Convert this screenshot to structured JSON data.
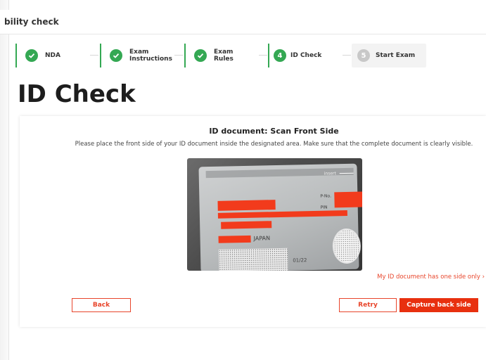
{
  "topbar": {
    "title": "bility check"
  },
  "stepper": {
    "steps": [
      {
        "label": "NDA",
        "state": "done"
      },
      {
        "label_line1": "Exam",
        "label_line2": "Instructions",
        "state": "done"
      },
      {
        "label_line1": "Exam",
        "label_line2": "Rules",
        "state": "done"
      },
      {
        "number": "4",
        "label": "ID Check",
        "state": "current"
      },
      {
        "number": "5",
        "label": "Start Exam",
        "state": "upcoming"
      }
    ]
  },
  "page": {
    "title": "ID Check"
  },
  "card": {
    "heading": "ID document: Scan Front Side",
    "description": "Please place the front side of your ID document inside the designated area. Make sure that the complete document is clearly visible.",
    "id_image": {
      "insert_label": "insert",
      "country": "JAPAN",
      "field_pno": "P-No.",
      "field_pin": "PIN",
      "expiry": "01/22"
    },
    "one_side_link": "My ID document has one side only",
    "buttons": {
      "back": "Back",
      "retry": "Retry",
      "capture_back": "Capture back side"
    }
  },
  "colors": {
    "accent": "#e8452b",
    "primary_button": "#e8300f",
    "done_green": "#34a853",
    "current_green": "#34a853",
    "upcoming_gray": "#c8c8c8",
    "redaction": "#f23b1c"
  }
}
